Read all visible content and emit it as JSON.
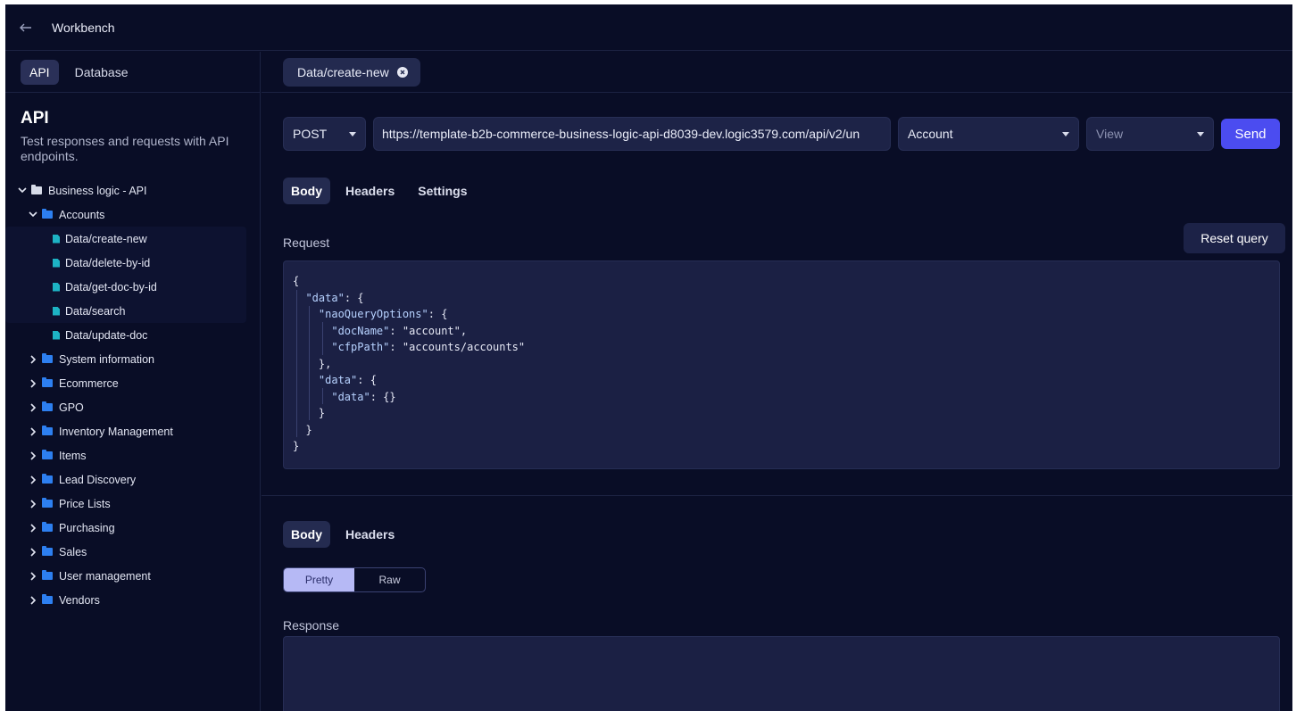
{
  "topbar": {
    "title": "Workbench"
  },
  "sidebar": {
    "tabs": [
      {
        "label": "API"
      },
      {
        "label": "Database"
      }
    ],
    "title": "API",
    "description": "Test responses and requests with API endpoints.",
    "tree": {
      "root": "Business logic - API",
      "accounts": {
        "label": "Accounts",
        "children": [
          "Data/create-new",
          "Data/delete-by-id",
          "Data/get-doc-by-id",
          "Data/search",
          "Data/update-doc"
        ]
      },
      "folders": [
        "System information",
        "Ecommerce",
        "GPO",
        "Inventory Management",
        "Items",
        "Lead Discovery",
        "Price Lists",
        "Purchasing",
        "Sales",
        "User management",
        "Vendors"
      ]
    }
  },
  "main": {
    "open_tab": "Data/create-new",
    "request": {
      "method": "POST",
      "url": "https://template-b2b-commerce-business-logic-api-d8039-dev.logic3579.com/api/v2/un",
      "entity": "Account",
      "view": "View",
      "send_label": "Send",
      "tabs": [
        "Body",
        "Headers",
        "Settings"
      ],
      "label": "Request",
      "reset_label": "Reset query",
      "body_lines": [
        "{",
        "  \"data\": {",
        "    \"naoQueryOptions\": {",
        "      \"docName\": \"account\",",
        "      \"cfpPath\": \"accounts/accounts\"",
        "    },",
        "    \"data\": {",
        "      \"data\": {}",
        "    }",
        "  }",
        "}"
      ]
    },
    "response": {
      "tabs": [
        "Body",
        "Headers"
      ],
      "format_options": [
        "Pretty",
        "Raw"
      ],
      "label": "Response"
    }
  },
  "colors": {
    "background": "#090d26",
    "accent": "#4b4cf0",
    "string": "#f2a184",
    "key": "#b7d2ff"
  }
}
